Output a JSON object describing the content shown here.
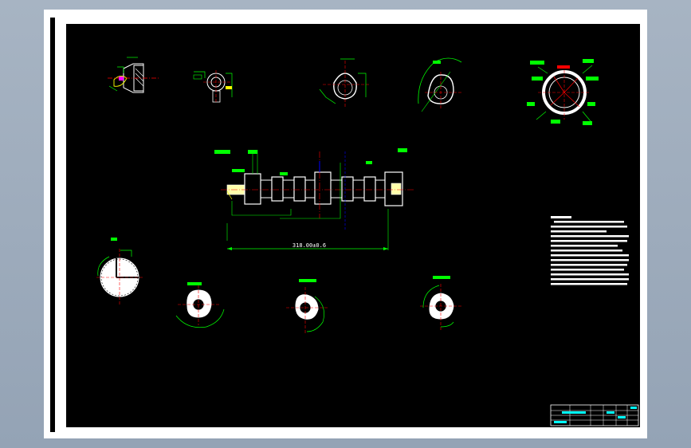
{
  "drawing": {
    "main_dimension": "318.00±0.6",
    "views": [
      {
        "id": "front-end-view"
      },
      {
        "id": "section-b"
      },
      {
        "id": "cam-detail-1"
      },
      {
        "id": "cam-detail-2"
      },
      {
        "id": "valve-timing-disc"
      },
      {
        "id": "camshaft-side-view"
      },
      {
        "id": "section-a"
      },
      {
        "id": "cam-section-1"
      },
      {
        "id": "cam-section-2"
      },
      {
        "id": "cam-section-3"
      }
    ],
    "technical_requirements": {
      "lines": 13
    },
    "title_block": {}
  },
  "colors": {
    "sheet": "#ffffff",
    "drawing_area": "#000000",
    "outline": "#ffffff",
    "dimension": "#00ff00",
    "center_line": "#ff0000",
    "leader": "#ffff00",
    "axis": "#0000ff",
    "border_chrome": "#9eadc0"
  }
}
